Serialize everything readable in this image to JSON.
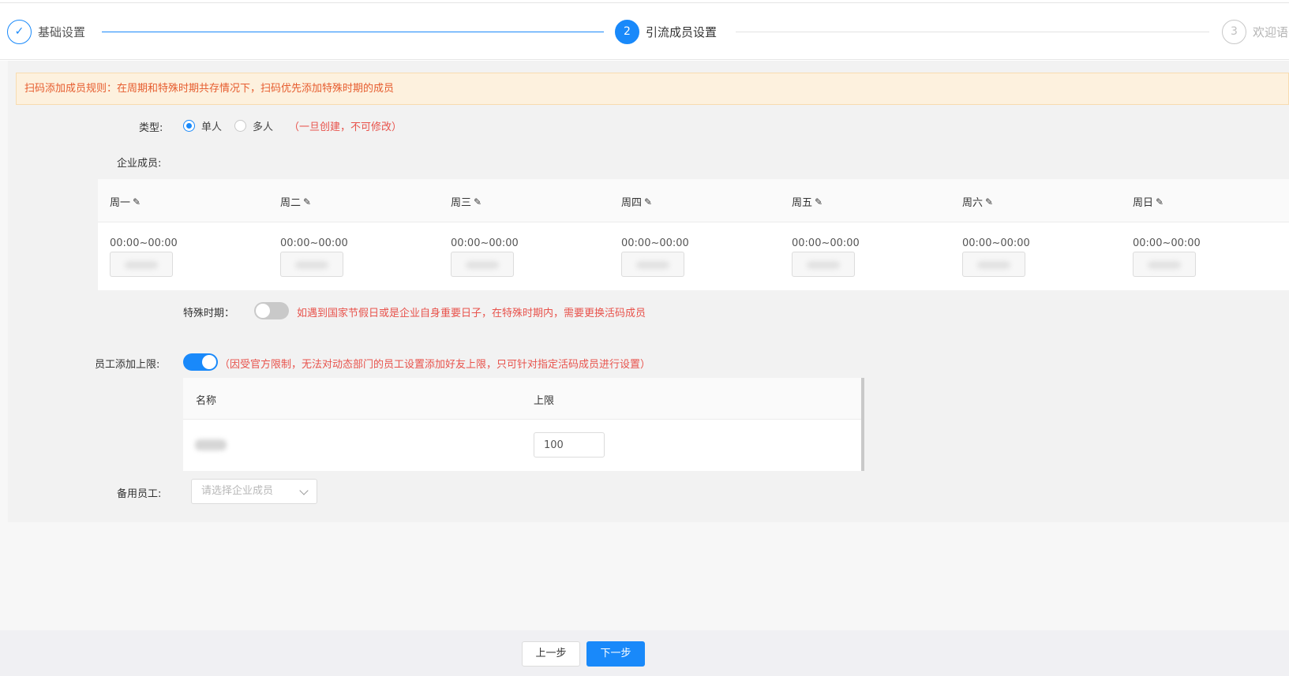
{
  "steps": [
    {
      "index": "✓",
      "label": "基础设置",
      "status": "done"
    },
    {
      "index": "2",
      "label": "引流成员设置",
      "status": "active"
    },
    {
      "index": "3",
      "label": "欢迎语",
      "status": "wait"
    }
  ],
  "notice": "扫码添加成员规则：在周期和特殊时期共存情况下，扫码优先添加特殊时期的成员",
  "type_field": {
    "label": "类型:",
    "options": [
      {
        "label": "单人",
        "checked": true
      },
      {
        "label": "多人",
        "checked": false
      }
    ],
    "hint": "（一旦创建，不可修改）"
  },
  "members_label": "企业成员:",
  "schedule": [
    {
      "day": "周一",
      "time": "00:00~00:00"
    },
    {
      "day": "周二",
      "time": "00:00~00:00"
    },
    {
      "day": "周三",
      "time": "00:00~00:00"
    },
    {
      "day": "周四",
      "time": "00:00~00:00"
    },
    {
      "day": "周五",
      "time": "00:00~00:00"
    },
    {
      "day": "周六",
      "time": "00:00~00:00"
    },
    {
      "day": "周日",
      "time": "00:00~00:00"
    }
  ],
  "special_period": {
    "label": "特殊时期：",
    "enabled": false,
    "hint": "如遇到国家节假日或是企业自身重要日子，在特殊时期内，需要更换活码成员"
  },
  "employee_limit": {
    "label": "员工添加上限:",
    "enabled": true,
    "hint": "（因受官方限制，无法对动态部门的员工设置添加好友上限，只可针对指定活码成员进行设置）",
    "columns": [
      "名称",
      "上限"
    ],
    "rows": [
      {
        "limit": "100"
      }
    ]
  },
  "backup": {
    "label": "备用员工:",
    "placeholder": "请选择企业成员"
  },
  "footer": {
    "prev": "上一步",
    "next": "下一步"
  },
  "colors": {
    "primary": "#1989fa",
    "warning_text": "#e65c2e",
    "hint_red": "#e8534c"
  }
}
